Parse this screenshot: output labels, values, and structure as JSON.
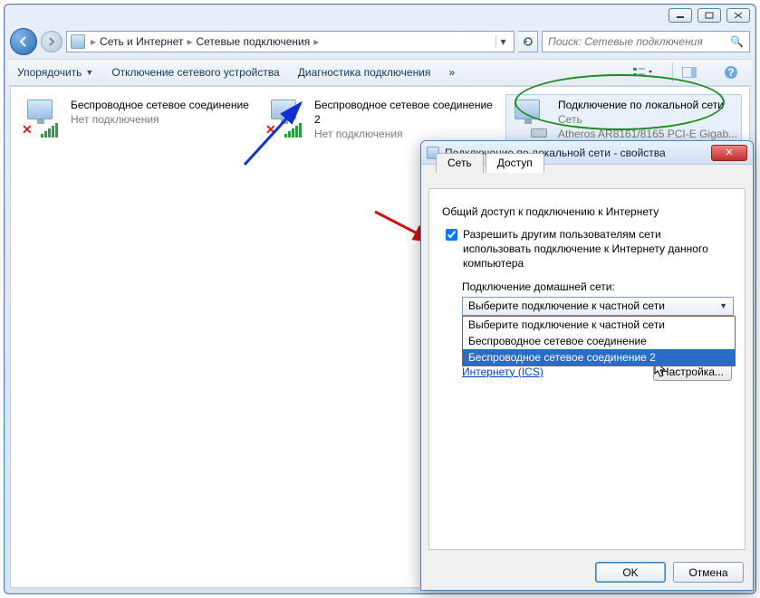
{
  "window": {
    "breadcrumb": {
      "seg1": "Сеть и Интернет",
      "seg2": "Сетевые подключения"
    },
    "search_placeholder": "Поиск: Сетевые подключения"
  },
  "toolbar": {
    "organize": "Упорядочить",
    "disable": "Отключение сетевого устройства",
    "diagnose": "Диагностика подключения"
  },
  "connections": [
    {
      "name": "Беспроводное сетевое соединение",
      "status": "Нет подключения",
      "type": "wifi",
      "disconnected": true
    },
    {
      "name": "Беспроводное сетевое соединение 2",
      "status": "Нет подключения",
      "type": "wifi",
      "disconnected": true
    },
    {
      "name": "Подключение по локальной сети",
      "status": "Сеть",
      "device": "Atheros AR8161/8165 PCI-E Gigab...",
      "type": "lan",
      "disconnected": false
    }
  ],
  "dialog": {
    "title": "Подключение по локальной сети - свойства",
    "tabs": {
      "network": "Сеть",
      "sharing": "Доступ"
    },
    "ics_section": "Общий доступ к подключению к Интернету",
    "allow_label": "Разрешить другим пользователям сети использовать подключение к Интернету данного компьютера",
    "home_conn_label": "Подключение домашней сети:",
    "combo_selected": "Выберите подключение к частной сети",
    "combo_options": [
      "Выберите подключение к частной сети",
      "Беспроводное сетевое соединение",
      "Беспроводное сетевое соединение 2"
    ],
    "ics_link": "Использование общего доступа к Интернету (ICS)",
    "settings_btn": "Настройка...",
    "ok": "OK",
    "cancel": "Отмена"
  }
}
